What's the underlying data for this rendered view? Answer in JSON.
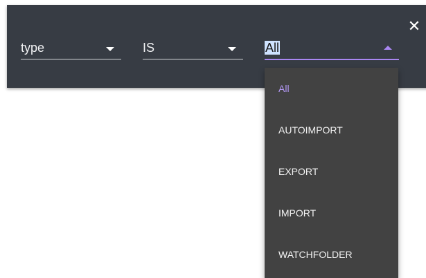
{
  "filter": {
    "field": {
      "value": "type"
    },
    "operator": {
      "value": "IS"
    },
    "value_select": {
      "value": "All"
    },
    "close_icon": "close-icon",
    "close_glyph": "✕"
  },
  "dropdown": {
    "options": [
      {
        "label": "All",
        "selected": true
      },
      {
        "label": "AUTOIMPORT",
        "selected": false
      },
      {
        "label": "EXPORT",
        "selected": false
      },
      {
        "label": "IMPORT",
        "selected": false
      },
      {
        "label": "WATCHFOLDER",
        "selected": false
      }
    ]
  },
  "colors": {
    "panel_bg": "#373c44",
    "menu_bg": "#424242",
    "accent": "#a987f2",
    "selected_text": "#b398f5",
    "text_highlight": "#cfe3ff"
  }
}
